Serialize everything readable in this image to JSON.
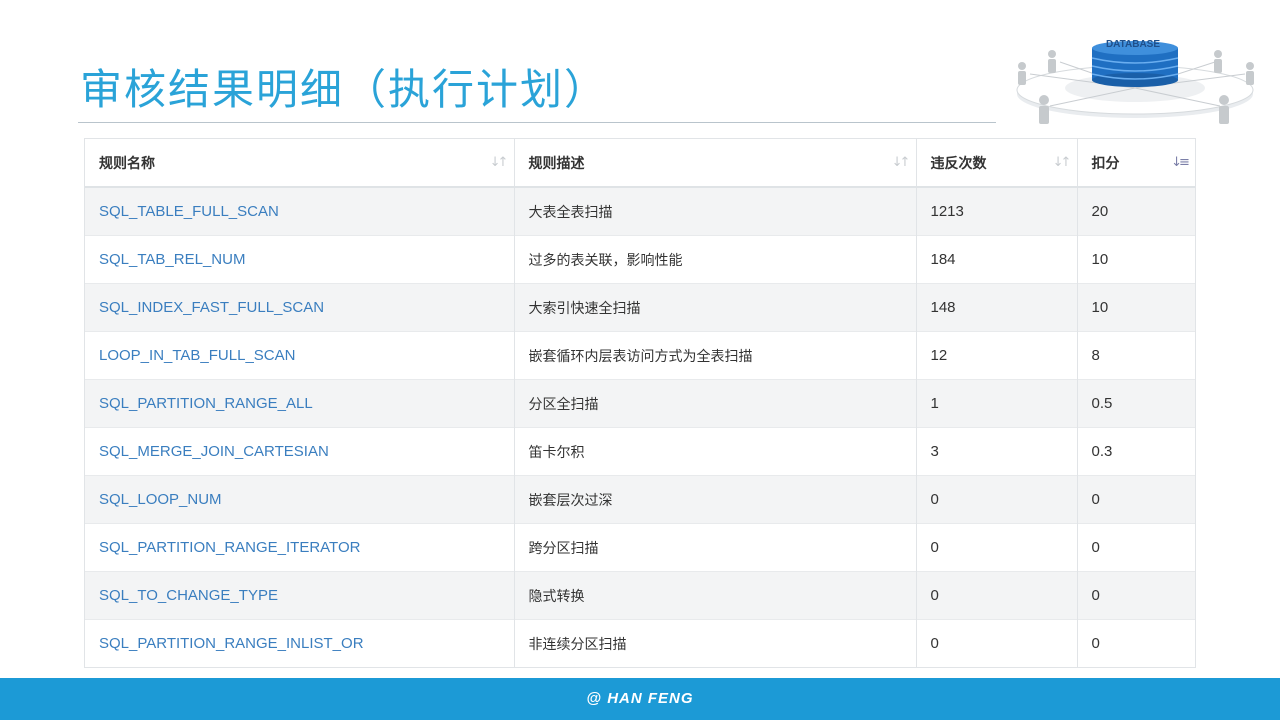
{
  "slide": {
    "title": "审核结果明细（执行计划）",
    "footer": "@ HAN FENG",
    "illustration_label": "DATABASE"
  },
  "table": {
    "headers": [
      "规则名称",
      "规则描述",
      "违反次数",
      "扣分"
    ],
    "sorted_column": "扣分",
    "rows": [
      {
        "rule": "SQL_TABLE_FULL_SCAN",
        "desc": "大表全表扫描",
        "count": "1213",
        "score": "20"
      },
      {
        "rule": "SQL_TAB_REL_NUM",
        "desc": "过多的表关联，影响性能",
        "count": "184",
        "score": "10"
      },
      {
        "rule": "SQL_INDEX_FAST_FULL_SCAN",
        "desc": "大索引快速全扫描",
        "count": "148",
        "score": "10"
      },
      {
        "rule": "LOOP_IN_TAB_FULL_SCAN",
        "desc": "嵌套循环内层表访问方式为全表扫描",
        "count": "12",
        "score": "8"
      },
      {
        "rule": "SQL_PARTITION_RANGE_ALL",
        "desc": "分区全扫描",
        "count": "1",
        "score": "0.5"
      },
      {
        "rule": "SQL_MERGE_JOIN_CARTESIAN",
        "desc": "笛卡尔积",
        "count": "3",
        "score": "0.3"
      },
      {
        "rule": "SQL_LOOP_NUM",
        "desc": "嵌套层次过深",
        "count": "0",
        "score": "0"
      },
      {
        "rule": "SQL_PARTITION_RANGE_ITERATOR",
        "desc": "跨分区扫描",
        "count": "0",
        "score": "0"
      },
      {
        "rule": "SQL_TO_CHANGE_TYPE",
        "desc": "隐式转换",
        "count": "0",
        "score": "0"
      },
      {
        "rule": "SQL_PARTITION_RANGE_INLIST_OR",
        "desc": "非连续分区扫描",
        "count": "0",
        "score": "0"
      }
    ]
  },
  "colors": {
    "title": "#2aa3d8",
    "rule_link": "#3a7ebf",
    "footer_bg": "#1c9ad6",
    "row_stripe": "#f3f4f5"
  },
  "icons": {
    "sort": "sort-arrows-icon",
    "sort_active": "sort-desc-icon",
    "illustration": "database-network-icon"
  }
}
